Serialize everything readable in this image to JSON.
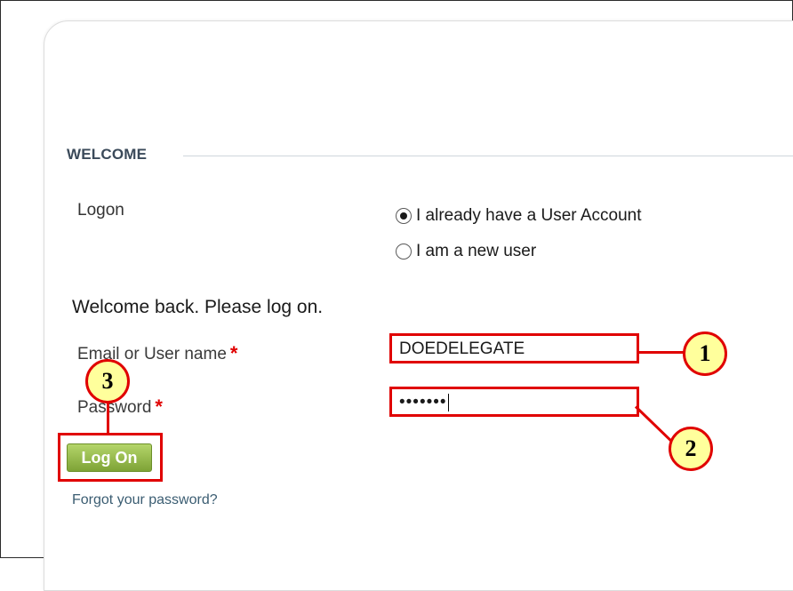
{
  "section": {
    "title": "WELCOME"
  },
  "logon": {
    "label": "Logon",
    "options": [
      {
        "label": "I already have a User Account",
        "selected": true
      },
      {
        "label": "I am a new user",
        "selected": false
      }
    ]
  },
  "form": {
    "welcome_message": "Welcome back. Please log on.",
    "email_label": "Email or User name",
    "email_value": "DOEDELEGATE",
    "password_label": "Password",
    "password_value": "•••••••",
    "required_marker": "*",
    "submit_label": "Log On",
    "forgot_link": "Forgot your password?"
  },
  "callouts": {
    "one": "1",
    "two": "2",
    "three": "3"
  },
  "colors": {
    "callout_border": "#e00000",
    "callout_fill": "#ffff9c",
    "button_green": "#7ea336",
    "link": "#3b5d72"
  }
}
